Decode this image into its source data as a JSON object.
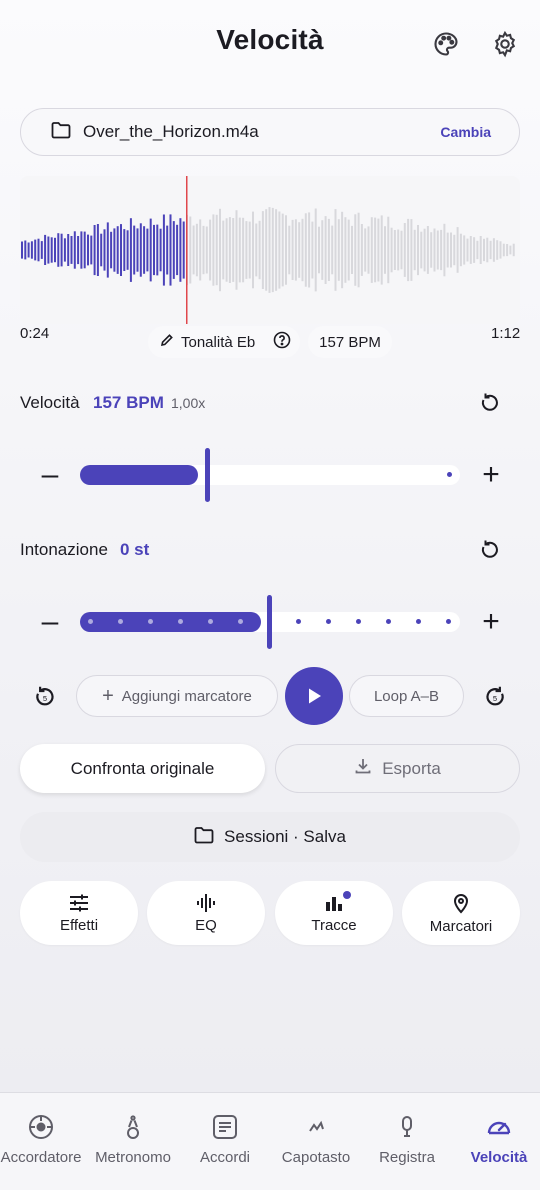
{
  "header": {
    "title": "Velocità",
    "icons": [
      "palette-icon",
      "gear-icon"
    ]
  },
  "file": {
    "icon": "folder-icon",
    "name": "Over_the_Horizon.m4a",
    "change_label": "Cambia"
  },
  "waveform": {
    "time_start": "0:24",
    "time_end": "1:12",
    "played_color": "#4b43b9",
    "unplayed_color": "#d8d8dc",
    "playhead_color": "#e0474c"
  },
  "chips": {
    "key_label": "Tonalità Eb",
    "bpm_label": "157 BPM"
  },
  "speed": {
    "label": "Velocità",
    "value": "157 BPM",
    "multiplier": "1,00x",
    "slider_fraction": 0.36
  },
  "pitch": {
    "label": "Intonazione",
    "value": "0 st",
    "slider_fraction": 0.5
  },
  "transport": {
    "add_marker_label": "Aggiungi marcatore",
    "loop_label": "Loop A–B"
  },
  "actions": {
    "compare_label": "Confronta originale",
    "export_label": "Esporta",
    "sessions_label": "Sessioni · Salva"
  },
  "tools": [
    {
      "label": "Effetti",
      "icon": "sliders-icon"
    },
    {
      "label": "EQ",
      "icon": "soundwave-icon"
    },
    {
      "label": "Tracce",
      "icon": "bars-icon"
    },
    {
      "label": "Marcatori",
      "icon": "pin-icon"
    }
  ],
  "nav": [
    {
      "label": "Accordatore",
      "icon": "tuner-icon"
    },
    {
      "label": "Metronomo",
      "icon": "metronome-icon"
    },
    {
      "label": "Accordi",
      "icon": "chords-icon"
    },
    {
      "label": "Capotasto",
      "icon": "capo-icon"
    },
    {
      "label": "Registra",
      "icon": "mic-icon"
    },
    {
      "label": "Velocità",
      "icon": "speedometer-icon"
    }
  ],
  "colors": {
    "accent": "#4b43b9",
    "background": "#f1f1f5"
  }
}
